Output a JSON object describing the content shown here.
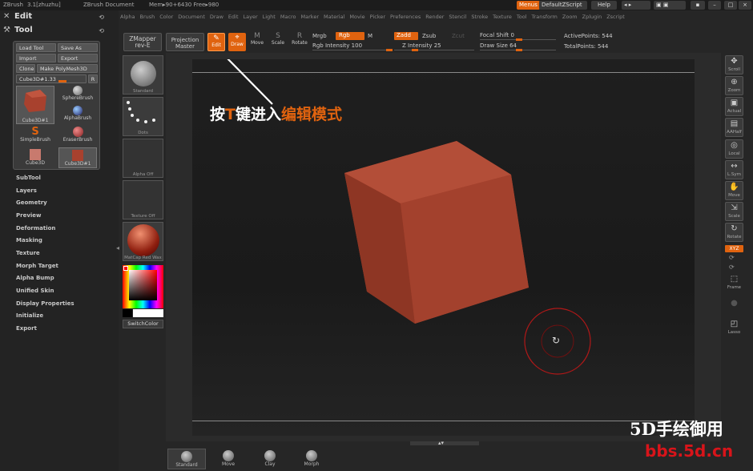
{
  "titlebar": {
    "app": "ZBrush",
    "version": "3.1[zhuzhu]",
    "doc": "ZBrush Document",
    "mem": "Mem▸90+6430  Free▸980",
    "menus": "Menus",
    "script": "DefaultZScript",
    "help": "Help"
  },
  "menubar": [
    "Alpha",
    "Brush",
    "Color",
    "Document",
    "Draw",
    "Edit",
    "Layer",
    "Light",
    "Macro",
    "Marker",
    "Material",
    "Movie",
    "Picker",
    "Preferences",
    "Render",
    "Stencil",
    "Stroke",
    "Texture",
    "Tool",
    "Transform",
    "Zoom",
    "Zplugin",
    "Zscript"
  ],
  "left_panel": {
    "edit_title": "Edit",
    "tool_title": "Tool",
    "buttons": {
      "load_tool": "Load Tool",
      "save_as": "Save As",
      "import": "Import",
      "export": "Export",
      "clone": "Clone",
      "make_polymesh": "Make PolyMesh3D",
      "current_tool": "Cube3D#1.33",
      "r": "R"
    },
    "thumbs": [
      "Cube3D#1",
      "SphereBrush",
      "AlphaBrush",
      "SimpleBrush",
      "EraserBrush",
      "Cube3D",
      "Cube3D#1"
    ],
    "menu_items": [
      "SubTool",
      "Layers",
      "Geometry",
      "Preview",
      "Deformation",
      "Masking",
      "Texture",
      "Morph Target",
      "Alpha Bump",
      "Unified Skin",
      "Display Properties",
      "Initialize",
      "Export"
    ]
  },
  "shelf": {
    "zmapper": "ZMapper",
    "zmapper_sub": "rev-E",
    "projection": "Projection",
    "projection_sub": "Master",
    "edit": "Edit",
    "draw": "Draw",
    "move": "Move",
    "scale": "Scale",
    "rotate": "Rotate",
    "mrgb": "Mrgb",
    "rgb": "Rgb",
    "m": "M",
    "rgb_intensity": "Rgb Intensity 100",
    "zadd": "Zadd",
    "zsub": "Zsub",
    "zcut": "Zcut",
    "z_intensity": "Z Intensity 25",
    "focal_shift": "Focal Shift 0",
    "draw_size": "Draw Size 64",
    "active_points": "ActivePoints: 544",
    "total_points": "TotalPoints: 544"
  },
  "left_shelf": {
    "items": [
      "Standard",
      "Dots",
      "Alpha Off",
      "Texture Off",
      "MatCap Red Wax"
    ],
    "switch_color": "SwitchColor"
  },
  "right_shelf": [
    "Scroll",
    "Zoom",
    "Actual",
    "AAHalf",
    "Local",
    "L.Sym",
    "Move",
    "Scale",
    "Rotate",
    "Frame",
    "Lasso"
  ],
  "right_shelf_xyz": "XYZ",
  "annotation": {
    "part1": "按",
    "part2": "T",
    "part3": "键进入",
    "part4": "编辑模式"
  },
  "bottom_bar": [
    "Standard",
    "Move",
    "Clay",
    "Morph"
  ],
  "watermark": {
    "line1": "5D手绘御用",
    "line2": "bbs.5d.cn"
  },
  "colors": {
    "accent": "#e0630f",
    "cube": "#a8412e"
  }
}
